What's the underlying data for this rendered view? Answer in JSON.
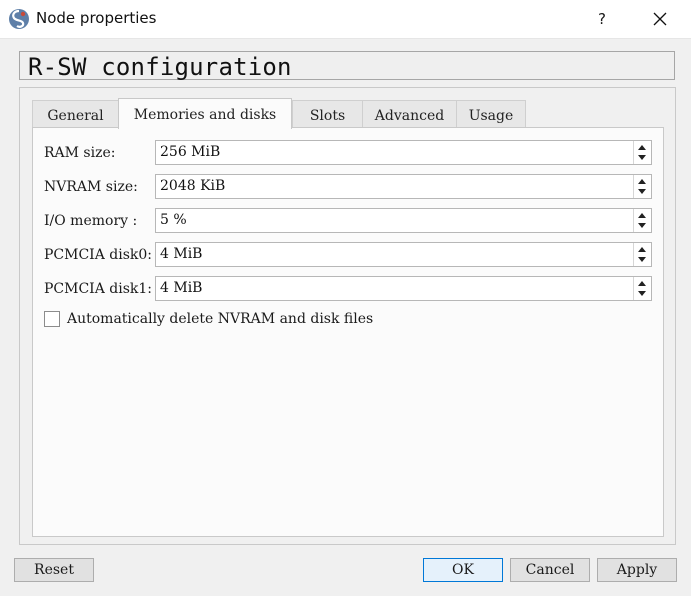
{
  "window": {
    "title": "Node properties",
    "help_label": "?",
    "accent": "#0078d7"
  },
  "header": {
    "title": "R-SW configuration"
  },
  "tabs": [
    {
      "label": "General"
    },
    {
      "label": "Memories and disks"
    },
    {
      "label": "Slots"
    },
    {
      "label": "Advanced"
    },
    {
      "label": "Usage"
    }
  ],
  "active_tab": "Memories and disks",
  "fields": {
    "ram": {
      "label": "RAM size:",
      "value": "256 MiB"
    },
    "nvram": {
      "label": "NVRAM size:",
      "value": "2048 KiB"
    },
    "io": {
      "label": "I/O memory :",
      "value": "5 %"
    },
    "disk0": {
      "label": "PCMCIA disk0:",
      "value": "4 MiB"
    },
    "disk1": {
      "label": "PCMCIA disk1:",
      "value": "4 MiB"
    }
  },
  "auto_delete": {
    "label": "Automatically delete NVRAM and disk files",
    "checked": false
  },
  "buttons": {
    "reset": "Reset",
    "ok": "OK",
    "cancel": "Cancel",
    "apply": "Apply"
  },
  "icons": {
    "app": "gns3-app-icon",
    "close": "close-icon",
    "spin_up": "spin-up-arrow-icon",
    "spin_down": "spin-down-arrow-icon"
  }
}
